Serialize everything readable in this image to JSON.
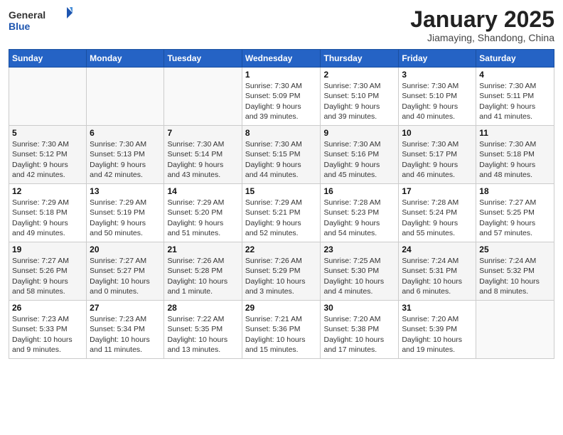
{
  "header": {
    "logo_general": "General",
    "logo_blue": "Blue",
    "month_title": "January 2025",
    "subtitle": "Jiamaying, Shandong, China"
  },
  "weekdays": [
    "Sunday",
    "Monday",
    "Tuesday",
    "Wednesday",
    "Thursday",
    "Friday",
    "Saturday"
  ],
  "weeks": [
    [
      {
        "day": "",
        "info": ""
      },
      {
        "day": "",
        "info": ""
      },
      {
        "day": "",
        "info": ""
      },
      {
        "day": "1",
        "info": "Sunrise: 7:30 AM\nSunset: 5:09 PM\nDaylight: 9 hours\nand 39 minutes."
      },
      {
        "day": "2",
        "info": "Sunrise: 7:30 AM\nSunset: 5:10 PM\nDaylight: 9 hours\nand 39 minutes."
      },
      {
        "day": "3",
        "info": "Sunrise: 7:30 AM\nSunset: 5:10 PM\nDaylight: 9 hours\nand 40 minutes."
      },
      {
        "day": "4",
        "info": "Sunrise: 7:30 AM\nSunset: 5:11 PM\nDaylight: 9 hours\nand 41 minutes."
      }
    ],
    [
      {
        "day": "5",
        "info": "Sunrise: 7:30 AM\nSunset: 5:12 PM\nDaylight: 9 hours\nand 42 minutes."
      },
      {
        "day": "6",
        "info": "Sunrise: 7:30 AM\nSunset: 5:13 PM\nDaylight: 9 hours\nand 42 minutes."
      },
      {
        "day": "7",
        "info": "Sunrise: 7:30 AM\nSunset: 5:14 PM\nDaylight: 9 hours\nand 43 minutes."
      },
      {
        "day": "8",
        "info": "Sunrise: 7:30 AM\nSunset: 5:15 PM\nDaylight: 9 hours\nand 44 minutes."
      },
      {
        "day": "9",
        "info": "Sunrise: 7:30 AM\nSunset: 5:16 PM\nDaylight: 9 hours\nand 45 minutes."
      },
      {
        "day": "10",
        "info": "Sunrise: 7:30 AM\nSunset: 5:17 PM\nDaylight: 9 hours\nand 46 minutes."
      },
      {
        "day": "11",
        "info": "Sunrise: 7:30 AM\nSunset: 5:18 PM\nDaylight: 9 hours\nand 48 minutes."
      }
    ],
    [
      {
        "day": "12",
        "info": "Sunrise: 7:29 AM\nSunset: 5:18 PM\nDaylight: 9 hours\nand 49 minutes."
      },
      {
        "day": "13",
        "info": "Sunrise: 7:29 AM\nSunset: 5:19 PM\nDaylight: 9 hours\nand 50 minutes."
      },
      {
        "day": "14",
        "info": "Sunrise: 7:29 AM\nSunset: 5:20 PM\nDaylight: 9 hours\nand 51 minutes."
      },
      {
        "day": "15",
        "info": "Sunrise: 7:29 AM\nSunset: 5:21 PM\nDaylight: 9 hours\nand 52 minutes."
      },
      {
        "day": "16",
        "info": "Sunrise: 7:28 AM\nSunset: 5:23 PM\nDaylight: 9 hours\nand 54 minutes."
      },
      {
        "day": "17",
        "info": "Sunrise: 7:28 AM\nSunset: 5:24 PM\nDaylight: 9 hours\nand 55 minutes."
      },
      {
        "day": "18",
        "info": "Sunrise: 7:27 AM\nSunset: 5:25 PM\nDaylight: 9 hours\nand 57 minutes."
      }
    ],
    [
      {
        "day": "19",
        "info": "Sunrise: 7:27 AM\nSunset: 5:26 PM\nDaylight: 9 hours\nand 58 minutes."
      },
      {
        "day": "20",
        "info": "Sunrise: 7:27 AM\nSunset: 5:27 PM\nDaylight: 10 hours\nand 0 minutes."
      },
      {
        "day": "21",
        "info": "Sunrise: 7:26 AM\nSunset: 5:28 PM\nDaylight: 10 hours\nand 1 minute."
      },
      {
        "day": "22",
        "info": "Sunrise: 7:26 AM\nSunset: 5:29 PM\nDaylight: 10 hours\nand 3 minutes."
      },
      {
        "day": "23",
        "info": "Sunrise: 7:25 AM\nSunset: 5:30 PM\nDaylight: 10 hours\nand 4 minutes."
      },
      {
        "day": "24",
        "info": "Sunrise: 7:24 AM\nSunset: 5:31 PM\nDaylight: 10 hours\nand 6 minutes."
      },
      {
        "day": "25",
        "info": "Sunrise: 7:24 AM\nSunset: 5:32 PM\nDaylight: 10 hours\nand 8 minutes."
      }
    ],
    [
      {
        "day": "26",
        "info": "Sunrise: 7:23 AM\nSunset: 5:33 PM\nDaylight: 10 hours\nand 9 minutes."
      },
      {
        "day": "27",
        "info": "Sunrise: 7:23 AM\nSunset: 5:34 PM\nDaylight: 10 hours\nand 11 minutes."
      },
      {
        "day": "28",
        "info": "Sunrise: 7:22 AM\nSunset: 5:35 PM\nDaylight: 10 hours\nand 13 minutes."
      },
      {
        "day": "29",
        "info": "Sunrise: 7:21 AM\nSunset: 5:36 PM\nDaylight: 10 hours\nand 15 minutes."
      },
      {
        "day": "30",
        "info": "Sunrise: 7:20 AM\nSunset: 5:38 PM\nDaylight: 10 hours\nand 17 minutes."
      },
      {
        "day": "31",
        "info": "Sunrise: 7:20 AM\nSunset: 5:39 PM\nDaylight: 10 hours\nand 19 minutes."
      },
      {
        "day": "",
        "info": ""
      }
    ]
  ]
}
